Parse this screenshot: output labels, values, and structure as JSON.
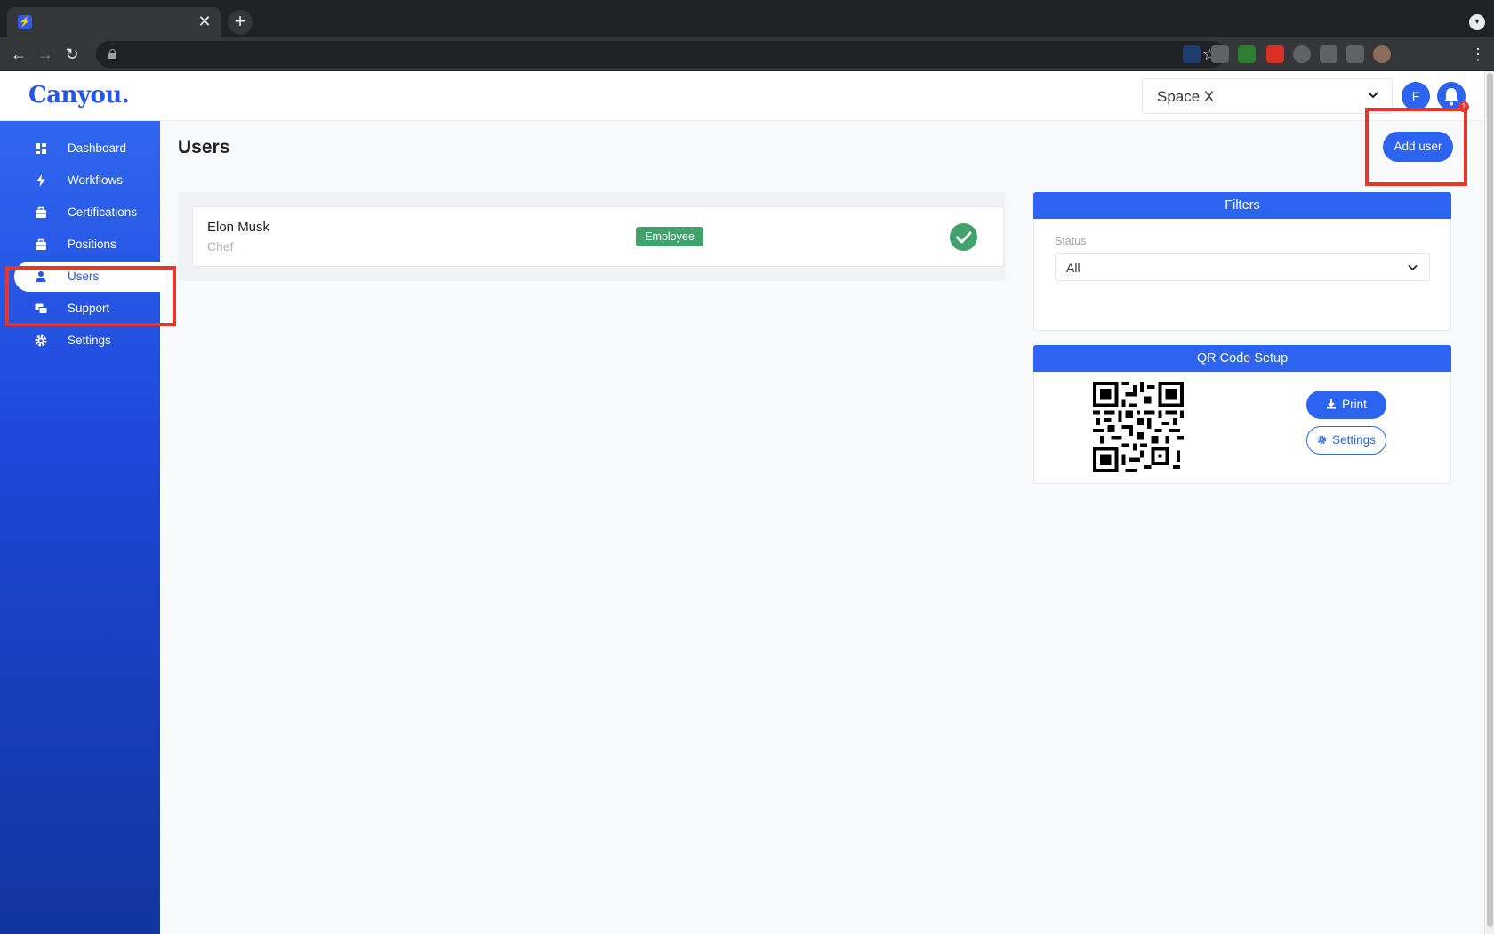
{
  "browser": {
    "tab_close_glyph": "✕",
    "new_tab_glyph": "+",
    "back_glyph": "←",
    "forward_glyph": "→",
    "reload_glyph": "↻",
    "star_glyph": "☆",
    "menu_glyph": "⋮"
  },
  "app": {
    "logo": "Canyou.",
    "workspace": "Space X",
    "avatar_initial": "F",
    "notification_count": "1"
  },
  "sidebar": {
    "items": [
      {
        "label": "Dashboard",
        "icon": "dashboard-icon"
      },
      {
        "label": "Workflows",
        "icon": "lightning-icon"
      },
      {
        "label": "Certifications",
        "icon": "briefcase-icon"
      },
      {
        "label": "Positions",
        "icon": "briefcase-icon"
      },
      {
        "label": "Users",
        "icon": "user-icon",
        "active": true
      },
      {
        "label": "Support",
        "icon": "support-icon"
      },
      {
        "label": "Settings",
        "icon": "gear-icon"
      }
    ]
  },
  "main": {
    "title": "Users",
    "add_user_label": "Add user",
    "users": [
      {
        "name": "Elon Musk",
        "role": "Chef",
        "badge": "Employee",
        "status": "active"
      }
    ]
  },
  "filters": {
    "title": "Filters",
    "status_label": "Status",
    "status_value": "All"
  },
  "qr": {
    "title": "QR Code Setup",
    "print_label": "Print",
    "settings_label": "Settings"
  },
  "colors": {
    "brand": "#2c63f0",
    "success": "#43a26c",
    "highlight": "#e6362b"
  }
}
